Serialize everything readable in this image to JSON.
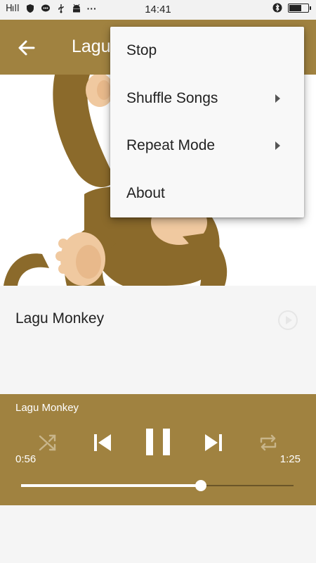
{
  "status_bar": {
    "signal": "H ​ ıll",
    "time": "14:41",
    "more": "···"
  },
  "app_bar": {
    "title": "Lagu Monkey"
  },
  "song_list": {
    "items": [
      {
        "title": "Lagu Monkey"
      }
    ]
  },
  "player": {
    "now_playing": "Lagu Monkey",
    "elapsed": "0:56",
    "duration": "1:25",
    "progress_fraction": 0.66
  },
  "menu": {
    "items": [
      {
        "label": "Stop",
        "has_submenu": false
      },
      {
        "label": "Shuffle Songs",
        "has_submenu": true
      },
      {
        "label": "Repeat Mode",
        "has_submenu": true
      },
      {
        "label": "About",
        "has_submenu": false
      }
    ]
  },
  "colors": {
    "accent": "#a08240",
    "monkey_fur": "#8b6a2b",
    "monkey_skin": "#f0c9a0"
  },
  "icons": {
    "back": "arrow-left-icon",
    "play": "play-circle-icon",
    "shuffle": "shuffle-icon",
    "previous": "skip-previous-icon",
    "pause": "pause-icon",
    "next": "skip-next-icon",
    "repeat": "repeat-icon"
  }
}
